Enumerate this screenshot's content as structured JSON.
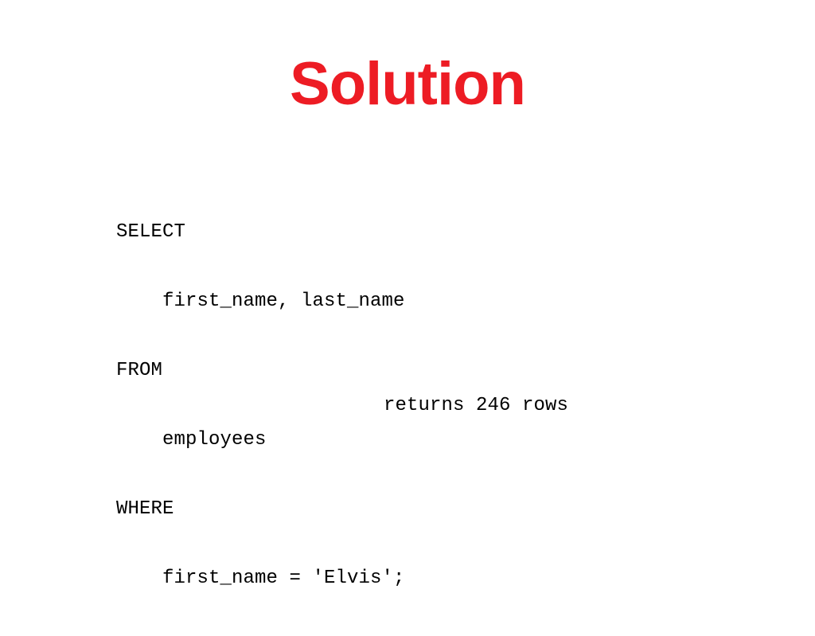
{
  "slide": {
    "background_color": "#FFFFFF",
    "title": "Solution",
    "title_color": "#ED1C24",
    "body_text_color": "#000000"
  },
  "code": {
    "language": "sql",
    "lines": [
      "SELECT",
      "    first_name, last_name",
      "FROM",
      "    employees",
      "WHERE",
      "    first_name = 'Elvis';"
    ]
  },
  "result": {
    "note": "returns 246 rows",
    "row_count": 246
  }
}
